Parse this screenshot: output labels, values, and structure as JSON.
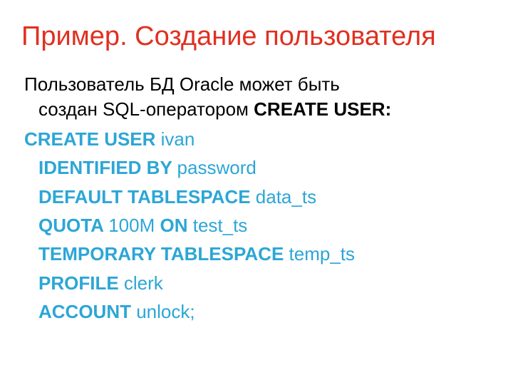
{
  "title": "Пример. Создание пользователя",
  "intro": {
    "line1": "Пользователь БД Oracle может быть",
    "line2_a": "создан SQL-оператором ",
    "line2_b": "CREATE USER:"
  },
  "code": {
    "l1_kw": "CREATE USER ",
    "l1_v": "ivan",
    "l2_kw": "IDENTIFIED BY ",
    "l2_v": "password",
    "l3_kw": "DEFAULT TABLESPACE ",
    "l3_v": "data_ts",
    "l4_kw1": "QUOTA ",
    "l4_v1": "100M ",
    "l4_kw2": "ON ",
    "l4_v2": "test_ts",
    "l5_kw": "TEMPORARY TABLESPACE ",
    "l5_v": "temp_ts",
    "l6_kw": "PROFILE ",
    "l6_v": "clerk",
    "l7_kw": "ACCOUNT ",
    "l7_v": "unlock;"
  }
}
